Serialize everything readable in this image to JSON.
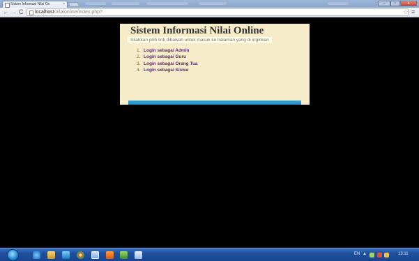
{
  "browser": {
    "tab_title": "Sistem Informasi Nilai On",
    "tab_close": "×",
    "url_host": "localhost",
    "url_path": "/nilaionline/index.php?",
    "nav_back": "←",
    "nav_forward": "→",
    "nav_reload": "C",
    "star": "☆",
    "menu": "≡",
    "win_min": "–",
    "win_max": "▫",
    "win_close": "x"
  },
  "page": {
    "title": "Sistem Informasi Nilai Online",
    "subtitle": "Silahkan pilih link dibawah untuk masuk ke halaman yang di inginkan",
    "links": [
      {
        "num": "1.",
        "label": "Login sebagai Admin"
      },
      {
        "num": "2.",
        "label": "Login sebagai Guru"
      },
      {
        "num": "3.",
        "label": "Login sebagai Orang Tua"
      },
      {
        "num": "4.",
        "label": "Login sebagai Siswa"
      }
    ]
  },
  "taskbar": {
    "lang": "EN",
    "tray_up": "▲",
    "time": "13:11",
    "icons": [
      "internet-explorer-icon",
      "file-explorer-icon",
      "media-player-icon",
      "chrome-icon",
      "photoshop-icon",
      "xampp-icon",
      "notepad-icon",
      "word-icon"
    ]
  }
}
